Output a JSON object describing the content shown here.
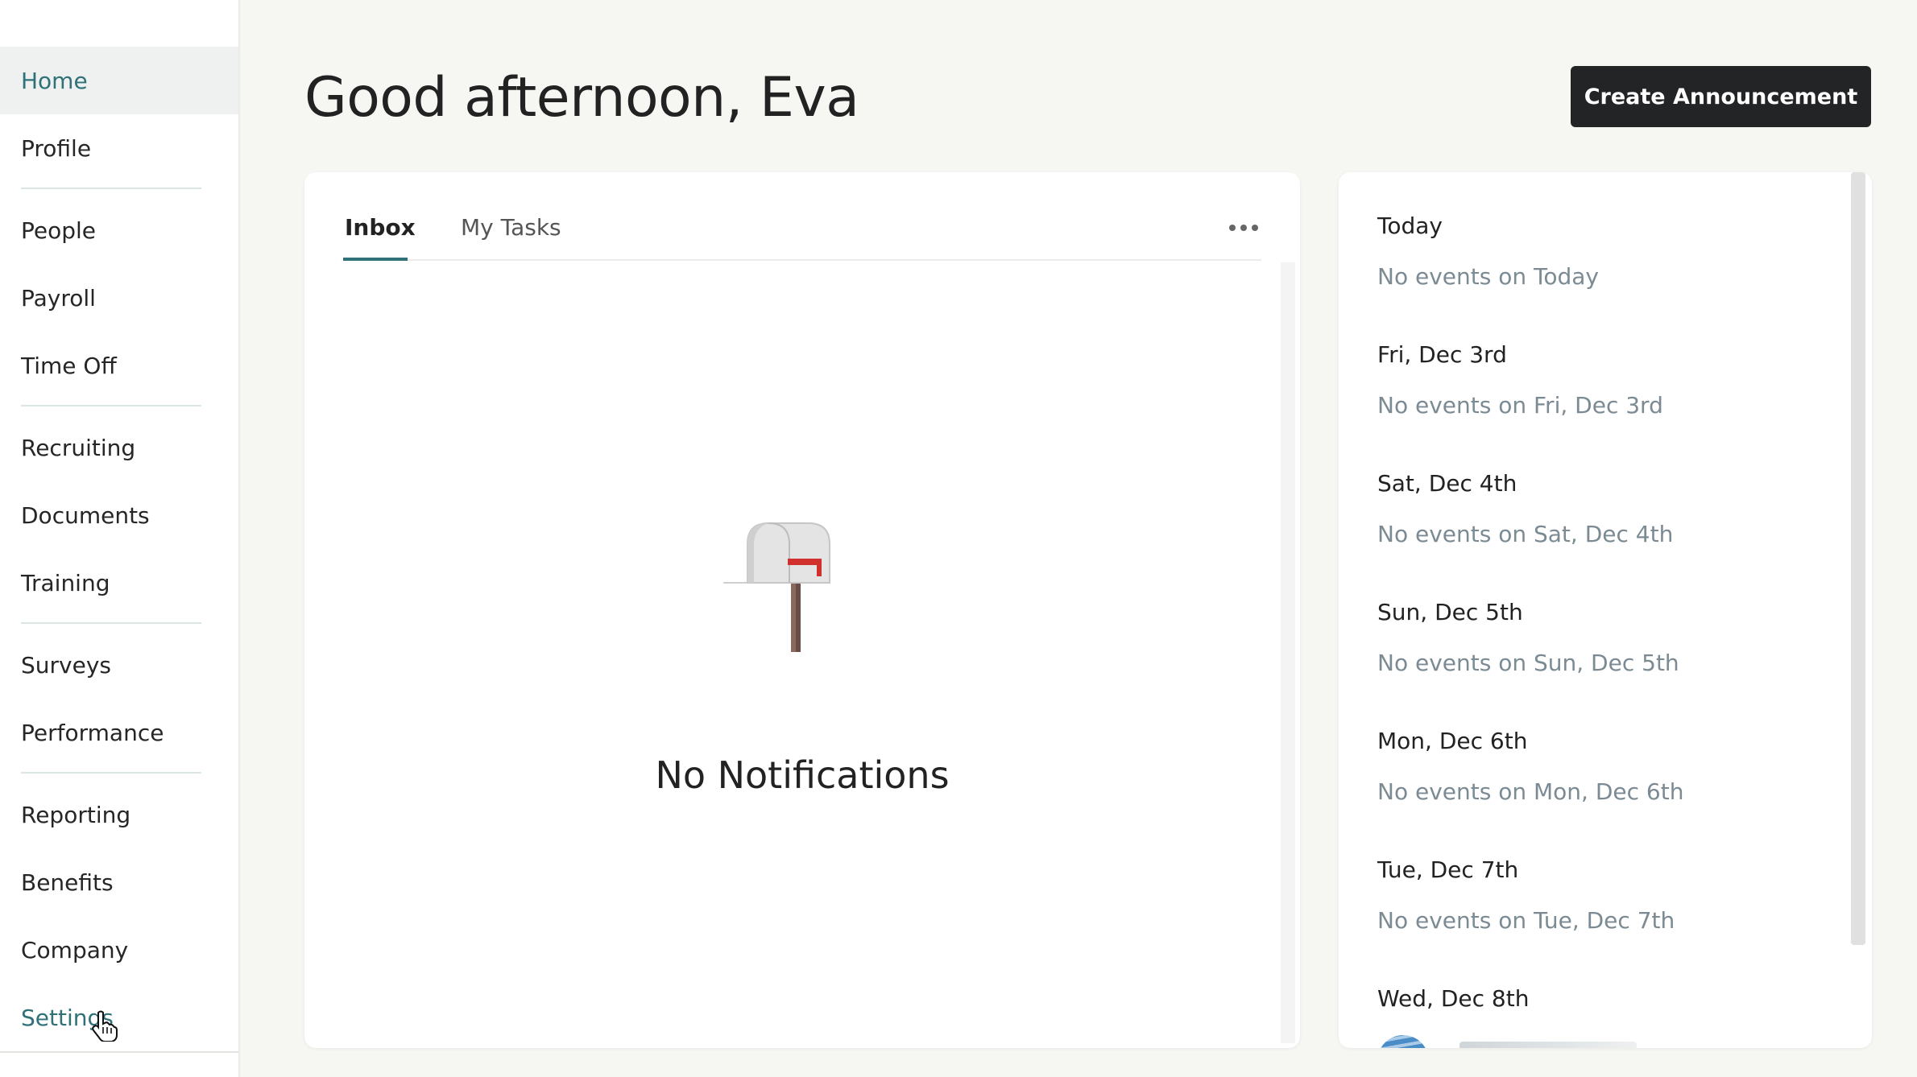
{
  "sidebar": {
    "items": [
      {
        "label": "Home",
        "active": true
      },
      {
        "label": "Profile"
      },
      {
        "label": "People"
      },
      {
        "label": "Payroll"
      },
      {
        "label": "Time Off"
      },
      {
        "label": "Recruiting"
      },
      {
        "label": "Documents"
      },
      {
        "label": "Training"
      },
      {
        "label": "Surveys"
      },
      {
        "label": "Performance"
      },
      {
        "label": "Reporting"
      },
      {
        "label": "Benefits"
      },
      {
        "label": "Company"
      },
      {
        "label": "Settings"
      }
    ]
  },
  "header": {
    "greeting": "Good afternoon, Eva",
    "create_label": "Create Announcement"
  },
  "inbox": {
    "tabs": [
      {
        "label": "Inbox",
        "active": true
      },
      {
        "label": "My Tasks"
      }
    ],
    "empty_title": "No Notifications",
    "icon": "mailbox-icon"
  },
  "calendar": {
    "days": [
      {
        "title": "Today",
        "empty": "No events on Today"
      },
      {
        "title": "Fri, Dec 3rd",
        "empty": "No events on Fri, Dec 3rd"
      },
      {
        "title": "Sat, Dec 4th",
        "empty": "No events on Sat, Dec 4th"
      },
      {
        "title": "Sun, Dec 5th",
        "empty": "No events on Sun, Dec 5th"
      },
      {
        "title": "Mon, Dec 6th",
        "empty": "No events on Mon, Dec 6th"
      },
      {
        "title": "Tue, Dec 7th",
        "empty": "No events on Tue, Dec 7th"
      },
      {
        "title": "Wed, Dec 8th"
      }
    ]
  },
  "colors": {
    "accent": "#2f7177",
    "button_dark": "#232426",
    "muted_text": "#7b8a93"
  }
}
